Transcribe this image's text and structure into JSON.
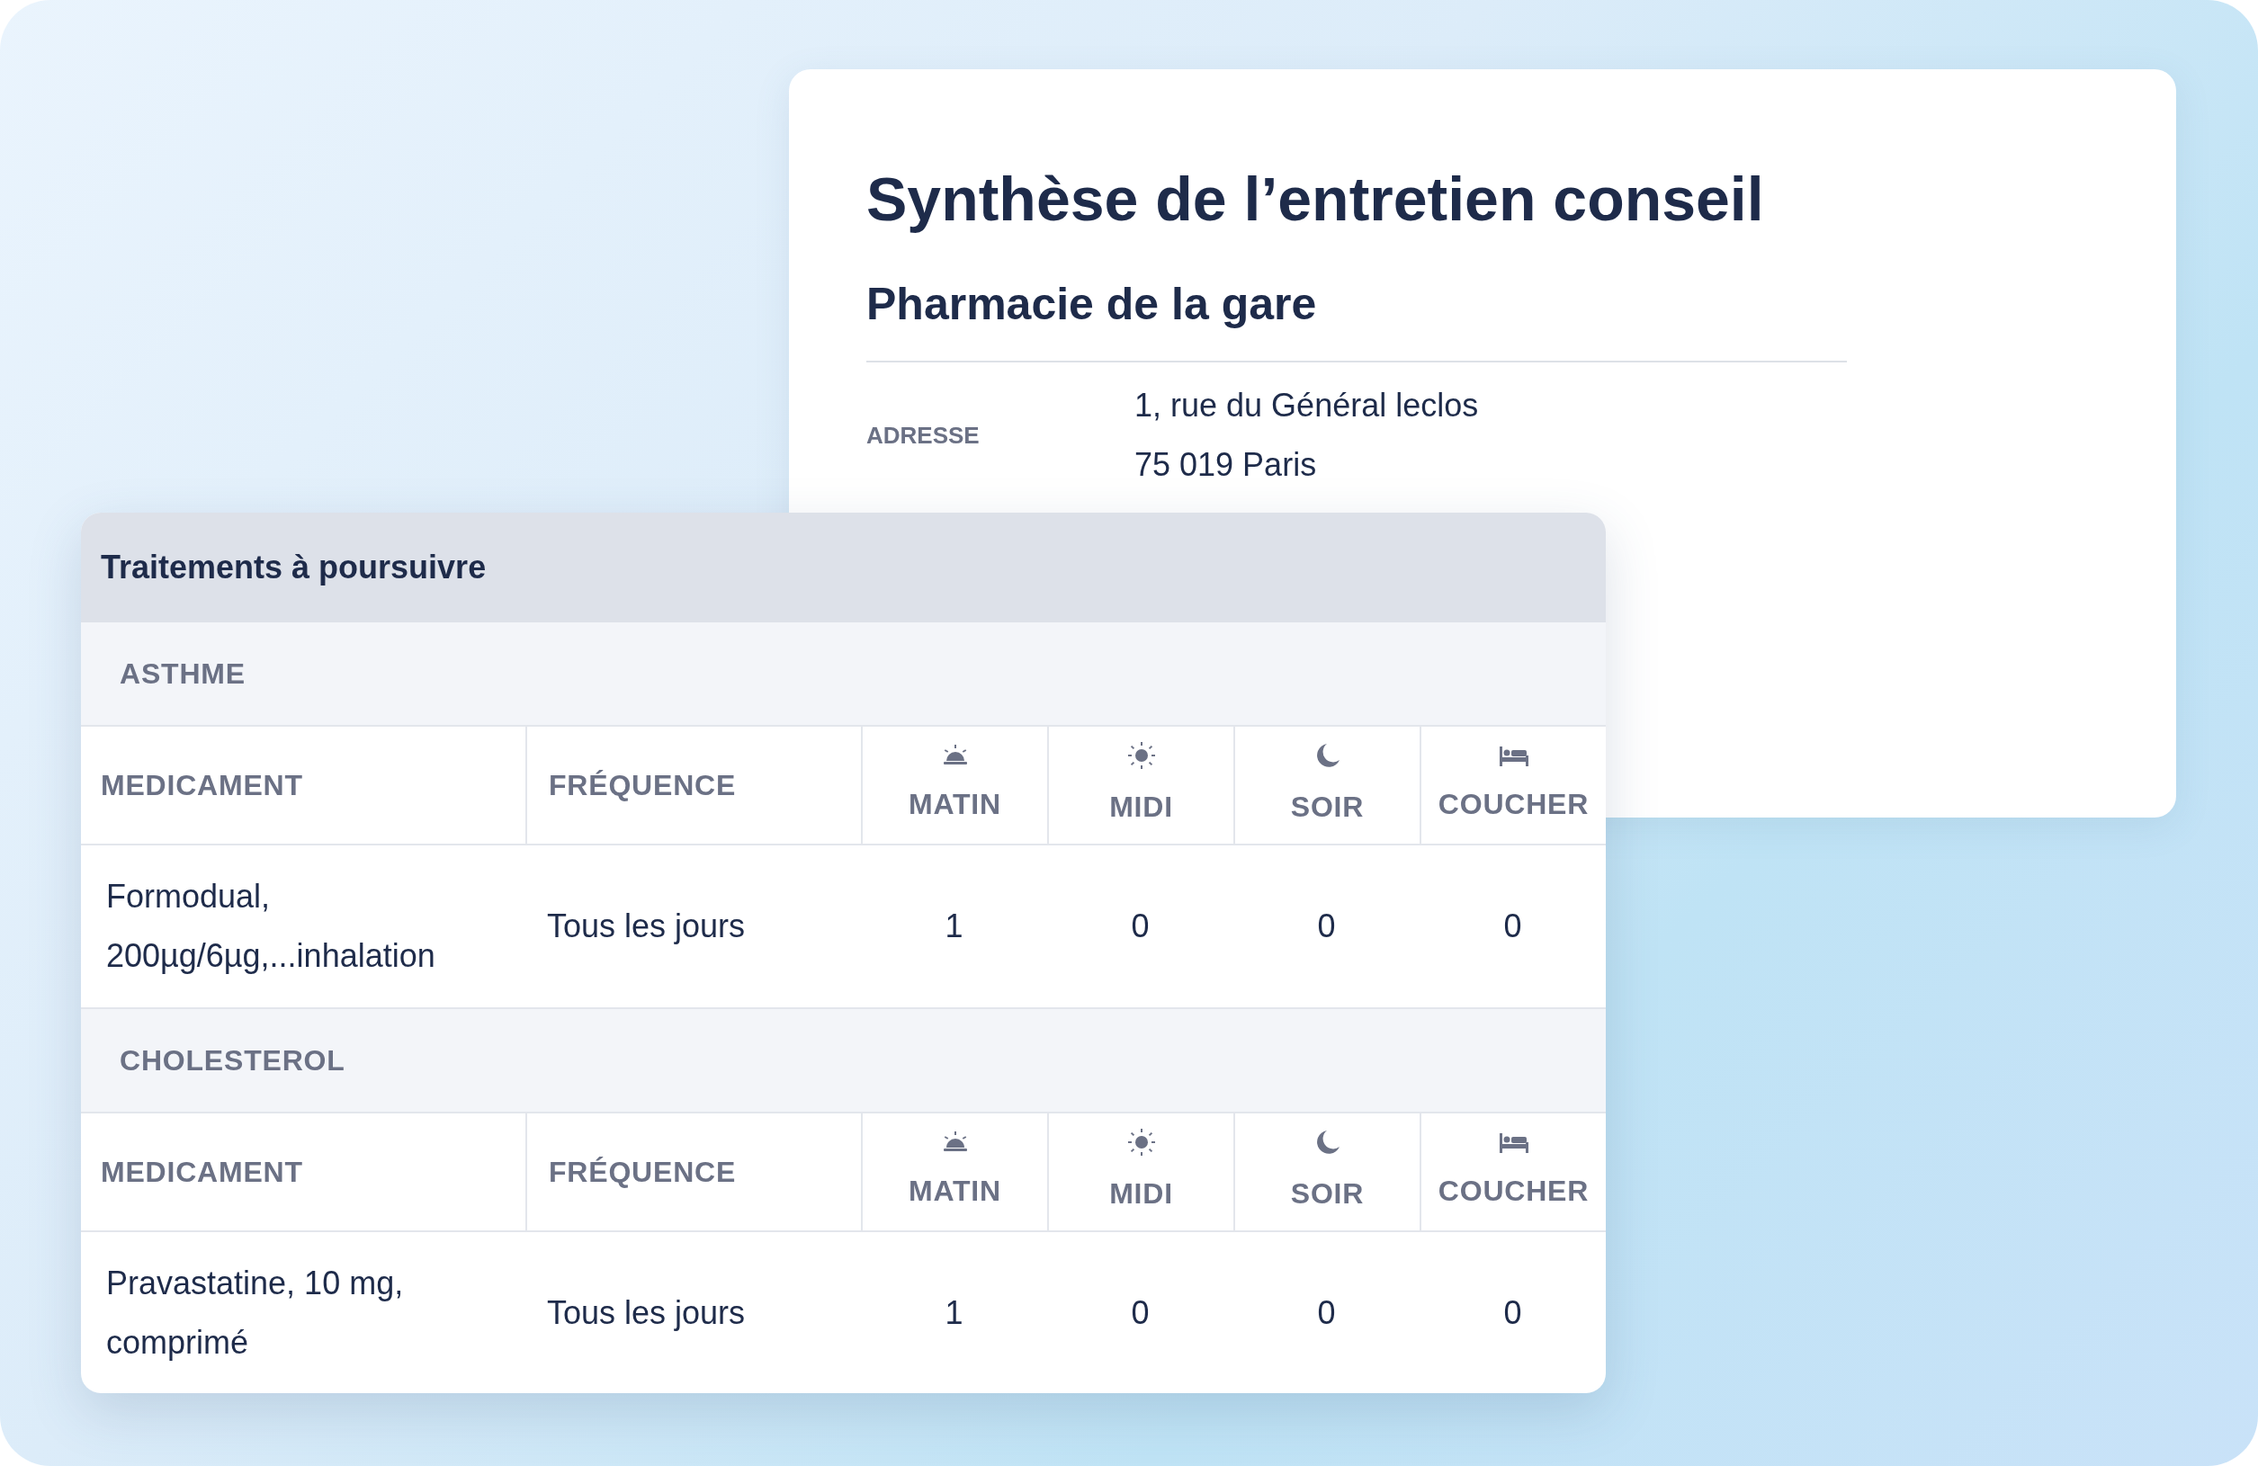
{
  "summary_card": {
    "title": "Synthèse de l’entretien conseil",
    "subtitle": "Pharmacie de la gare",
    "address_label": "ADRESSE",
    "address_lines": [
      "1, rue du Général leclos",
      "75 019 Paris"
    ]
  },
  "treatments_card": {
    "title": "Traitements à poursuivre",
    "groups": [
      {
        "name": "ASTHME",
        "columns": [
          {
            "label": "MEDICAMENT",
            "kind": "text"
          },
          {
            "label": "FRÉQUENCE",
            "kind": "text"
          },
          {
            "label": "MATIN",
            "kind": "time"
          },
          {
            "label": "MIDI",
            "kind": "time"
          },
          {
            "label": "SOIR",
            "kind": "time"
          },
          {
            "label": "COUCHER",
            "kind": "time"
          }
        ],
        "rows": [
          {
            "cells": [
              "Formodual, 200µg/6µg,...inhalation",
              "Tous les jours",
              "1",
              "0",
              "0",
              "0"
            ]
          }
        ]
      },
      {
        "name": "CHOLESTEROL",
        "columns": [
          {
            "label": "MEDICAMENT",
            "kind": "text"
          },
          {
            "label": "FRÉQUENCE",
            "kind": "text"
          },
          {
            "label": "MATIN",
            "kind": "time"
          },
          {
            "label": "MIDI",
            "kind": "time"
          },
          {
            "label": "SOIR",
            "kind": "time"
          },
          {
            "label": "COUCHER",
            "kind": "time"
          }
        ],
        "rows": [
          {
            "cells": [
              "Pravastatine, 10 mg, comprimé",
              "Tous les jours",
              "1",
              "0",
              "0",
              "0"
            ]
          }
        ]
      }
    ]
  }
}
